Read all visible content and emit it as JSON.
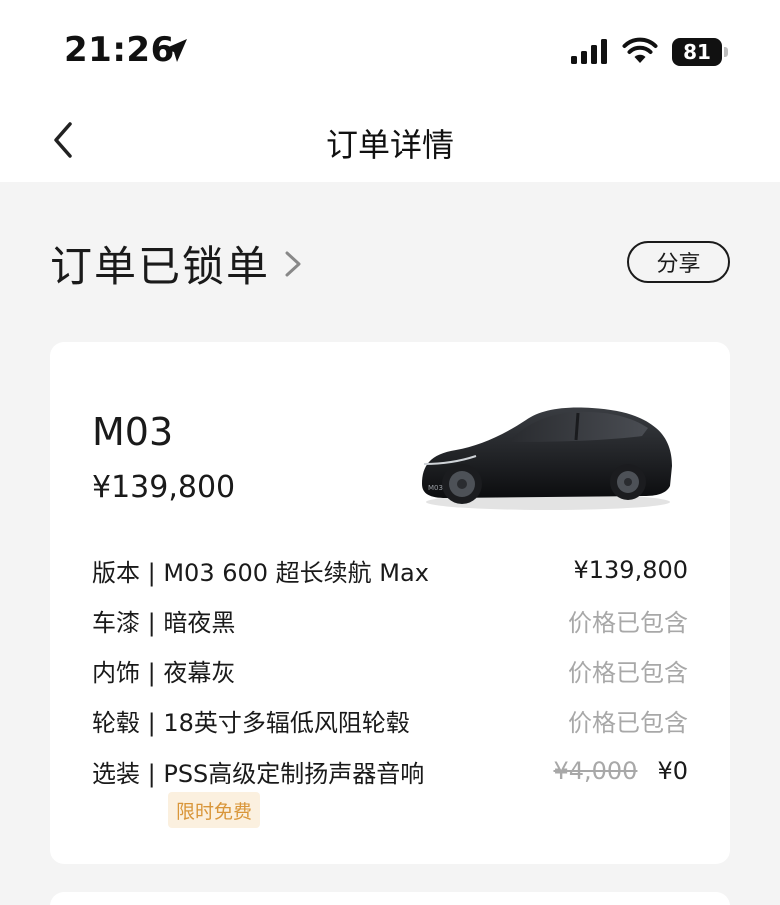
{
  "status_bar": {
    "time": "21:26",
    "battery": "81"
  },
  "nav": {
    "title": "订单详情"
  },
  "order": {
    "status": "订单已锁单",
    "share_label": "分享"
  },
  "car": {
    "model": "M03",
    "price": "¥139,800",
    "badge_text": "M03"
  },
  "specs": [
    {
      "label": "版本 | M03 600 超长续航 Max",
      "value": "¥139,800"
    },
    {
      "label": "车漆 | 暗夜黑",
      "value": "价格已包含"
    },
    {
      "label": "内饰 | 夜幕灰",
      "value": "价格已包含"
    },
    {
      "label": "轮毂 | 18英寸多辐低风阻轮毂",
      "value": "价格已包含"
    },
    {
      "label": "选装 | PSS高级定制扬声器音响",
      "original_price": "¥4,000",
      "value": "¥0",
      "promo": "限时免费"
    }
  ],
  "icons": [
    "location-arrow-icon",
    "signal-icon",
    "wifi-icon",
    "battery-icon",
    "back-icon",
    "chevron-right-icon"
  ],
  "colors": {
    "text": "#1a1a1a",
    "muted": "#a8a8a8",
    "promo_text": "#d9963a",
    "promo_bg": "#fbf0df",
    "page_bg": "#f4f4f4"
  }
}
